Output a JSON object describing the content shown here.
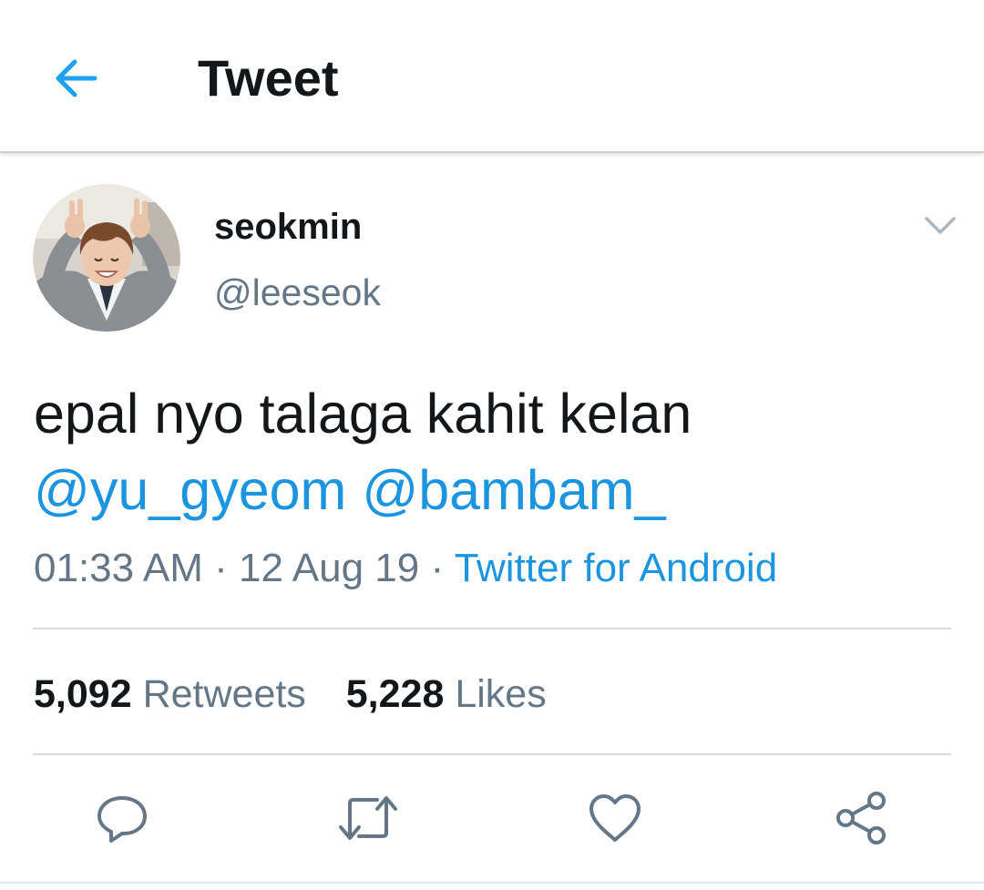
{
  "header": {
    "title": "Tweet",
    "back_icon": "arrow-left-icon"
  },
  "author": {
    "display_name": "seokmin",
    "handle": "@leeseok",
    "avatar_icon": "avatar-photo"
  },
  "tweet": {
    "text": "epal nyo talaga kahit kelan",
    "mentions": [
      "@yu_gyeom",
      "@bambam_"
    ],
    "time": "01:33 AM",
    "date": "12 Aug 19",
    "separator": "·",
    "source": "Twitter for Android"
  },
  "stats": {
    "retweets_count": "5,092",
    "retweets_label": "Retweets",
    "likes_count": "5,228",
    "likes_label": "Likes"
  },
  "actions": [
    {
      "icon": "reply-icon"
    },
    {
      "icon": "retweet-icon"
    },
    {
      "icon": "like-icon"
    },
    {
      "icon": "share-icon"
    }
  ],
  "colors": {
    "accent": "#1da1f2",
    "link": "#1b95e0",
    "text": "#14171a",
    "secondary": "#657786",
    "icon": "#657786"
  }
}
